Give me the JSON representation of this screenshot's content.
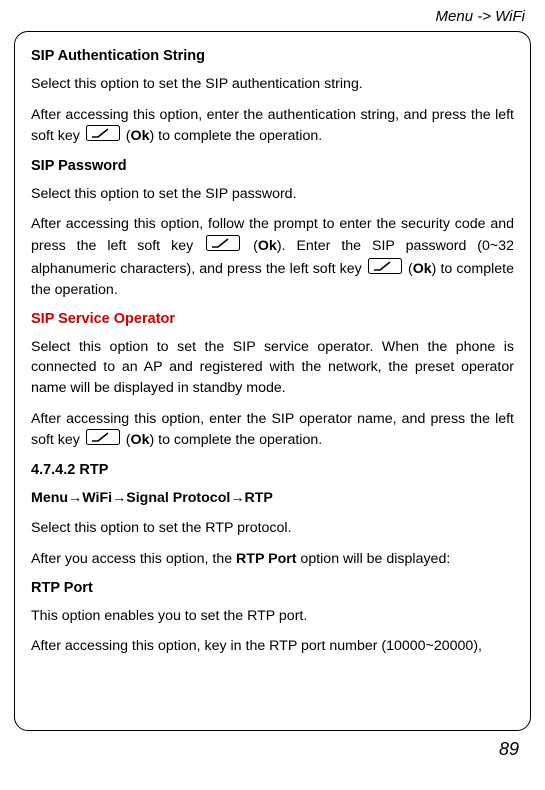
{
  "breadcrumb": "Menu -> WiFi",
  "section1": {
    "heading": "SIP Authentication String",
    "p1": "Select this option to set the SIP authentication string.",
    "p2a": "After accessing this option, enter the authentication string, and press the left soft key ",
    "p2b": " (",
    "ok": "Ok",
    "p2c": ") to complete the operation."
  },
  "section2": {
    "heading": "SIP Password",
    "p1": "Select this option to set the SIP password.",
    "p2a": "After accessing this option, follow the prompt to enter the security code and press the left soft key ",
    "p2b": " (",
    "ok1": "Ok",
    "p2c": "). Enter the SIP password (0~32 alphanumeric characters), and press the left soft key ",
    "p2d": " (",
    "ok2": "Ok",
    "p2e": ") to complete the operation."
  },
  "section3": {
    "heading": "SIP Service Operator",
    "p1": "Select this option to set the SIP service operator. When the phone is connected to an AP and registered with the network, the preset operator name will be displayed in standby mode.",
    "p2a": "After accessing this option, enter the SIP operator name, and press the left soft key ",
    "p2b": " (",
    "ok": "Ok",
    "p2c": ") to complete the operation."
  },
  "section4": {
    "heading": "4.7.4.2 RTP",
    "nava": "Menu",
    "arrow": "→",
    "navb": "WiFi",
    "navc": "Signal Protocol",
    "navd": "RTP",
    "p1": "Select this option to set the RTP protocol.",
    "p2a": "After you access this option, the ",
    "p2b": "RTP Port",
    "p2c": " option will be displayed:"
  },
  "section5": {
    "heading": "RTP Port",
    "p1": "This option enables you to set the RTP port.",
    "p2": "After accessing this option, key in the RTP port number (10000~20000),"
  },
  "pageNumber": "89"
}
